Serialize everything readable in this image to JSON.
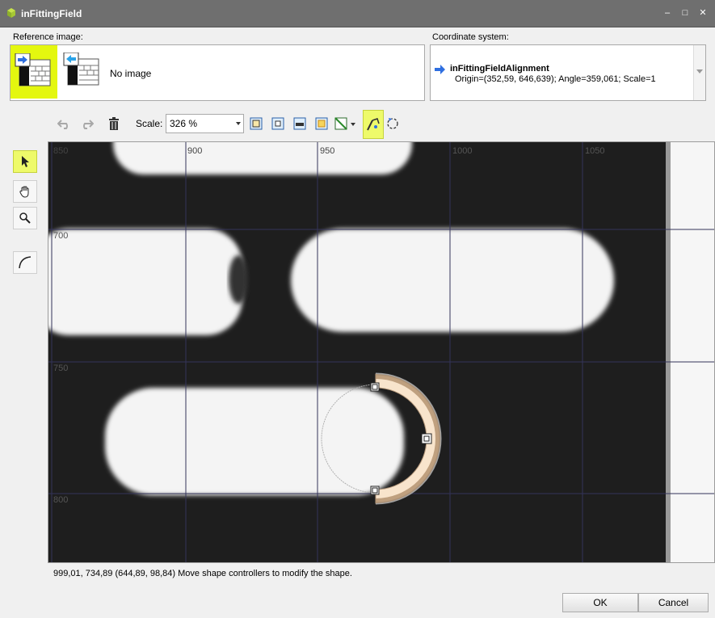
{
  "window": {
    "title": "inFittingField",
    "controls": [
      "–",
      "□",
      "✕"
    ]
  },
  "reference": {
    "label": "Reference image:",
    "no_image": "No image"
  },
  "coordinate": {
    "label": "Coordinate system:",
    "name": "inFittingFieldAlignment",
    "details": "Origin=(352,59, 646,639); Angle=359,061; Scale=1"
  },
  "toolbar": {
    "scale_label": "Scale:",
    "scale_value": "326 %"
  },
  "canvas": {
    "x_ticks": [
      "850",
      "900",
      "950",
      "1000",
      "1050"
    ],
    "y_ticks": [
      "700",
      "750",
      "800"
    ]
  },
  "status": {
    "text": "999,01, 734,89 (644,89, 98,84)  Move shape controllers to modify the shape."
  },
  "buttons": {
    "ok": "OK",
    "cancel": "Cancel"
  },
  "colors": {
    "title_bar": "#6f6f6f",
    "selection_yellow": "#e4f70f",
    "arc_fill": "#f8e4cc",
    "arc_edge": "#b79a7c"
  }
}
